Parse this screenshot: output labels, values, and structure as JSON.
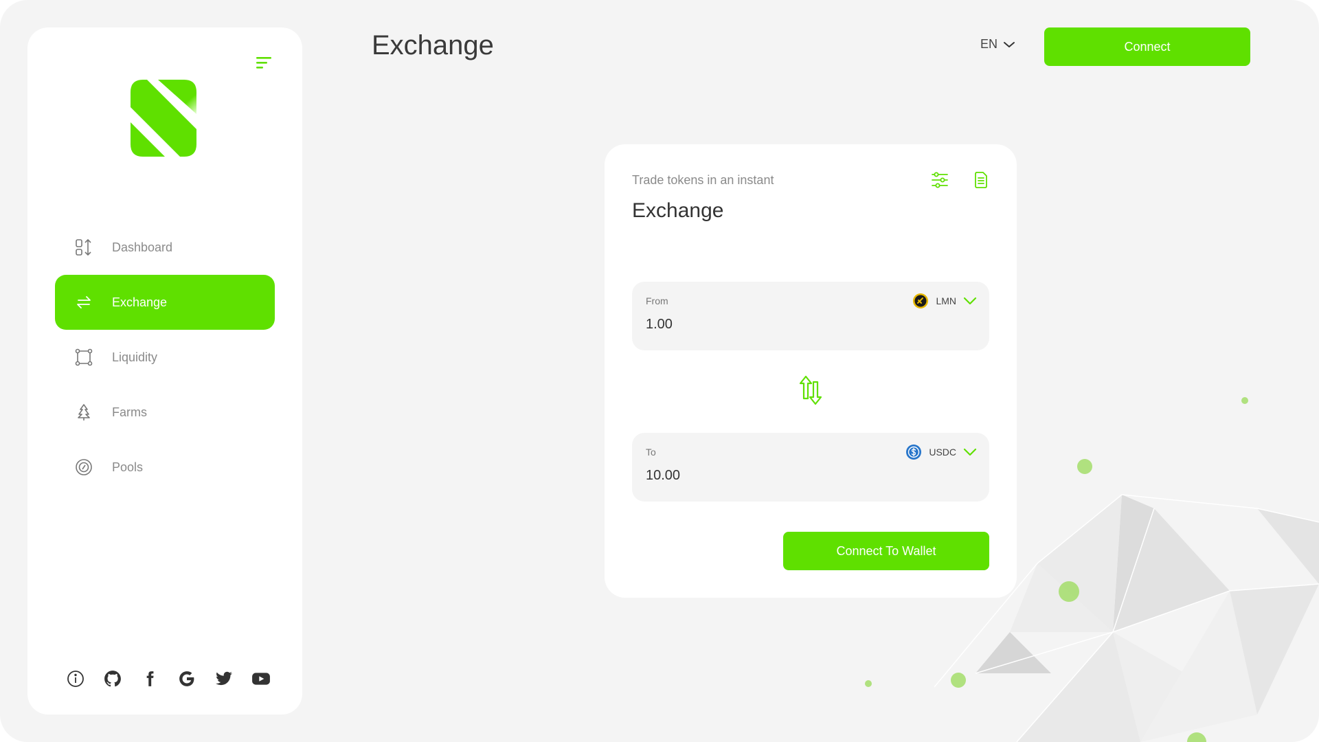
{
  "header": {
    "title": "Exchange",
    "language": "EN",
    "connect_label": "Connect"
  },
  "sidebar": {
    "items": [
      {
        "label": "Dashboard",
        "icon": "dashboard-icon"
      },
      {
        "label": "Exchange",
        "icon": "exchange-icon",
        "active": true
      },
      {
        "label": "Liquidity",
        "icon": "liquidity-icon"
      },
      {
        "label": "Farms",
        "icon": "tree-icon"
      },
      {
        "label": "Pools",
        "icon": "pool-icon"
      }
    ],
    "social": [
      "info-icon",
      "github-icon",
      "facebook-icon",
      "google-icon",
      "twitter-icon",
      "youtube-icon"
    ]
  },
  "card": {
    "subtitle": "Trade tokens in an instant",
    "title": "Exchange",
    "from": {
      "label": "From",
      "value": "1.00",
      "token": "LMN"
    },
    "to": {
      "label": "To",
      "value": "10.00",
      "token": "USDC"
    },
    "wallet_button": "Connect To Wallet"
  },
  "colors": {
    "accent": "#5fe000",
    "background": "#f4f4f4",
    "card": "#ffffff"
  }
}
